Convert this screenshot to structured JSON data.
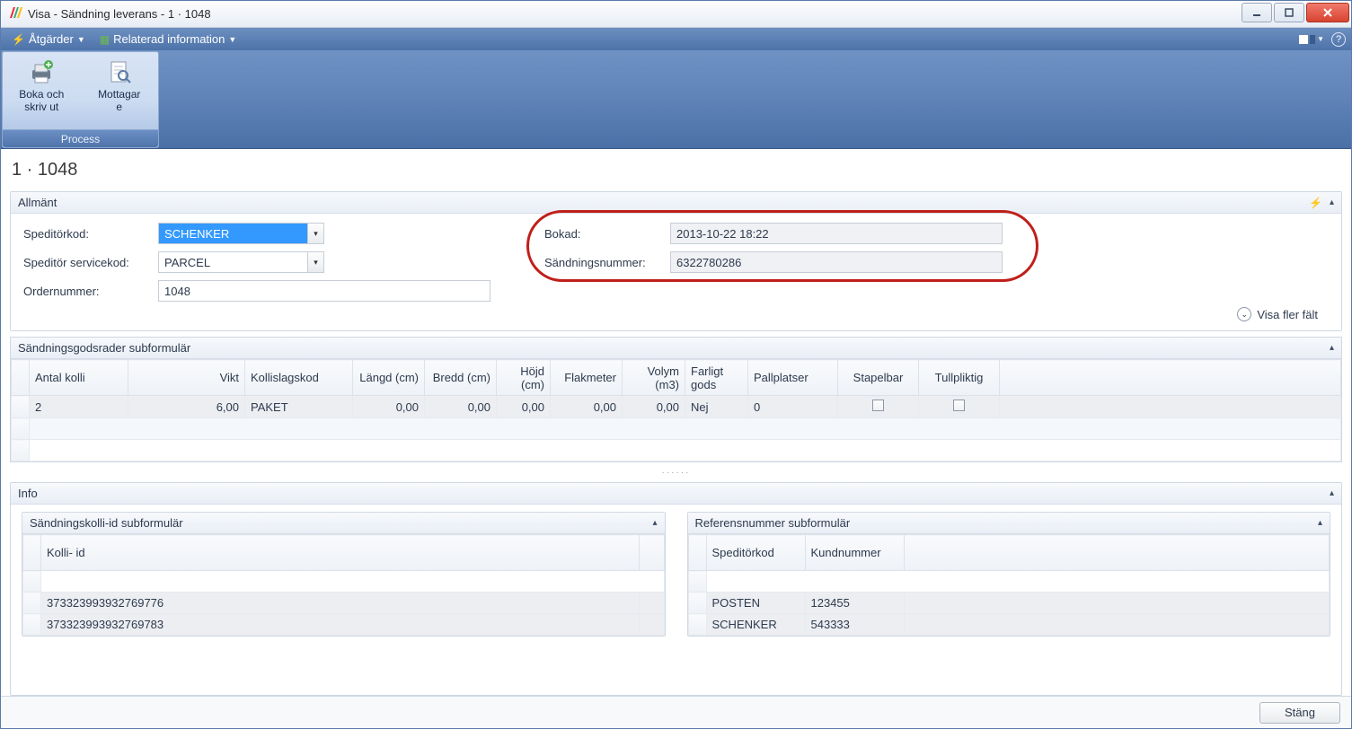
{
  "window": {
    "title": "Visa - Sändning leverans - 1 · 1048"
  },
  "menubar": {
    "actions": "Åtgärder",
    "related": "Relaterad information"
  },
  "ribbon": {
    "group_title": "Process",
    "btn1_line1": "Boka och",
    "btn1_line2": "skriv ut",
    "btn2_line1": "Mottagar",
    "btn2_line2": "e"
  },
  "page_title": "1 · 1048",
  "general": {
    "header": "Allmänt",
    "speditorkod_label": "Speditörkod:",
    "speditorkod_value": "SCHENKER",
    "servicekod_label": "Speditör servicekod:",
    "servicekod_value": "PARCEL",
    "ordernummer_label": "Ordernummer:",
    "ordernummer_value": "1048",
    "bokad_label": "Bokad:",
    "bokad_value": "2013-10-22 18:22",
    "sandningsnummer_label": "Sändningsnummer:",
    "sandningsnummer_value": "6322780286",
    "show_more": "Visa fler fält"
  },
  "goods": {
    "header": "Sändningsgodsrader subformulär",
    "columns": {
      "antal_kolli": "Antal kolli",
      "vikt": "Vikt",
      "kollislagskod": "Kollislagskod",
      "langd": "Längd (cm)",
      "bredd": "Bredd (cm)",
      "hojd": "Höjd (cm)",
      "flakmeter": "Flakmeter",
      "volym": "Volym (m3)",
      "farligt": "Farligt gods",
      "pallplatser": "Pallplatser",
      "stapelbar": "Stapelbar",
      "tullpliktig": "Tullpliktig"
    },
    "rows": [
      {
        "antal_kolli": "2",
        "vikt": "6,00",
        "kollislagskod": "PAKET",
        "langd": "0,00",
        "bredd": "0,00",
        "hojd": "0,00",
        "flakmeter": "0,00",
        "volym": "0,00",
        "farligt": "Nej",
        "pallplatser": "0"
      }
    ]
  },
  "info": {
    "header": "Info",
    "kolli": {
      "header": "Sändningskolli-id subformulär",
      "col_kolli_id": "Kolli- id",
      "rows": [
        {
          "id": "373323993932769776"
        },
        {
          "id": "373323993932769783"
        }
      ]
    },
    "ref": {
      "header": "Referensnummer subformulär",
      "col_speditorkod": "Speditörkod",
      "col_kundnummer": "Kundnummer",
      "rows": [
        {
          "speditorkod": "POSTEN",
          "kundnummer": "123455"
        },
        {
          "speditorkod": "SCHENKER",
          "kundnummer": "543333"
        }
      ]
    }
  },
  "footer": {
    "close": "Stäng"
  }
}
